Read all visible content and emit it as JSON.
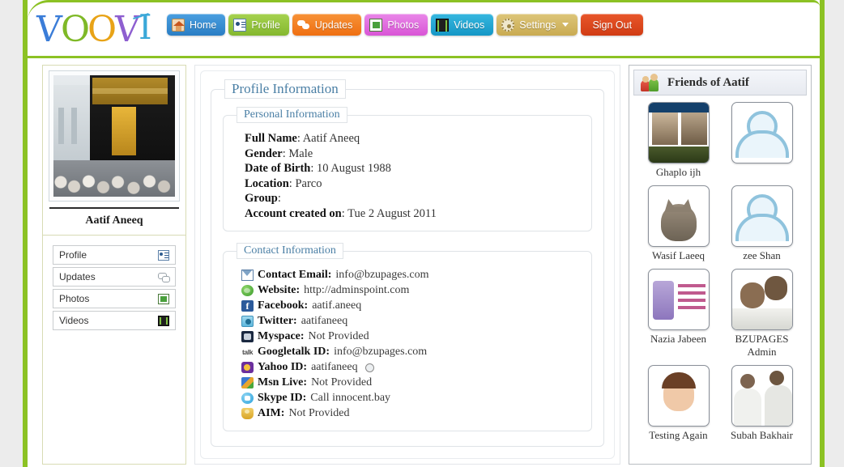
{
  "site": {
    "logo_letters": [
      "V",
      "O",
      "O",
      "V",
      "I"
    ]
  },
  "nav": {
    "items": [
      {
        "label": "Home",
        "icon": "house-icon",
        "color": "#2a7ec4"
      },
      {
        "label": "Profile",
        "icon": "card-icon",
        "color": "#84b82f"
      },
      {
        "label": "Updates",
        "icon": "bubbles-icon",
        "color": "#ef6f12"
      },
      {
        "label": "Photos",
        "icon": "photo-icon",
        "color": "#d955d6"
      },
      {
        "label": "Videos",
        "icon": "film-icon",
        "color": "#1597c6"
      },
      {
        "label": "Settings",
        "icon": "gear-icon",
        "color": "#c9ab52",
        "has_caret": true
      },
      {
        "label": "Sign Out",
        "icon": "",
        "color": "#d13c14"
      }
    ]
  },
  "left_sidebar": {
    "profile_name": "Aatif Aneeq",
    "photo_alt": "kaaba-profile-photo",
    "menu": [
      {
        "label": "Profile",
        "icon": "card-icon"
      },
      {
        "label": "Updates",
        "icon": "bubbles-icon"
      },
      {
        "label": "Photos",
        "icon": "photo-icon"
      },
      {
        "label": "Videos",
        "icon": "film-icon"
      }
    ]
  },
  "main": {
    "profile_information_legend": "Profile Information",
    "personal_information_legend": "Personal Information",
    "personal_fields": [
      {
        "label": "Full Name",
        "value": "Aatif Aneeq"
      },
      {
        "label": "Gender",
        "value": "Male"
      },
      {
        "label": "Date of Birth",
        "value": "10 August 1988"
      },
      {
        "label": "Location",
        "value": "Parco"
      },
      {
        "label": "Group",
        "value": ""
      },
      {
        "label": "Account created on",
        "value": "Tue 2 August 2011"
      }
    ],
    "contact_information_legend": "Contact Information",
    "contact_fields": [
      {
        "label": "Contact Email:",
        "value": "info@bzupages.com",
        "icon": "mail-icon"
      },
      {
        "label": "Website:",
        "value": "http://adminspoint.com",
        "icon": "globe-icon"
      },
      {
        "label": "Facebook:",
        "value": "aatif.aneeq",
        "icon": "facebook-icon"
      },
      {
        "label": "Twitter:",
        "value": "aatifaneeq",
        "icon": "twitter-icon"
      },
      {
        "label": "Myspace:",
        "value": "Not Provided",
        "icon": "myspace-icon"
      },
      {
        "label": "Googletalk ID:",
        "value": "info@bzupages.com",
        "icon": "googletalk-icon"
      },
      {
        "label": "Yahoo ID:",
        "value": "aatifaneeq",
        "icon": "yahoo-icon",
        "has_smiley": true
      },
      {
        "label": "Msn Live:",
        "value": "Not Provided",
        "icon": "msn-icon"
      },
      {
        "label": "Skype ID:",
        "value": "Call innocent.bay",
        "icon": "skype-icon"
      },
      {
        "label": "AIM:",
        "value": "Not Provided",
        "icon": "aim-icon"
      }
    ]
  },
  "right_sidebar": {
    "title": "Friends of Aatif",
    "header_icon": "two-people-icon",
    "friends": [
      {
        "name": "Ghaplo ijh",
        "avatar": "av-ghaplo"
      },
      {
        "name": "",
        "avatar": "av-placeholder"
      },
      {
        "name": "Wasif Laeeq",
        "avatar": "av-cat"
      },
      {
        "name": "zee Shan",
        "avatar": "av-placeholder"
      },
      {
        "name": "Nazia Jabeen",
        "avatar": "av-card"
      },
      {
        "name": "BZUPAGES Admin",
        "avatar": "av-men"
      },
      {
        "name": "Testing Again",
        "avatar": "av-baby"
      },
      {
        "name": "Subah Bakhair",
        "avatar": "av-group"
      }
    ]
  },
  "theme": {
    "frame_green": "#8cc224",
    "page_bg": "#ececec",
    "legend_blue": "#4a7fa5"
  }
}
